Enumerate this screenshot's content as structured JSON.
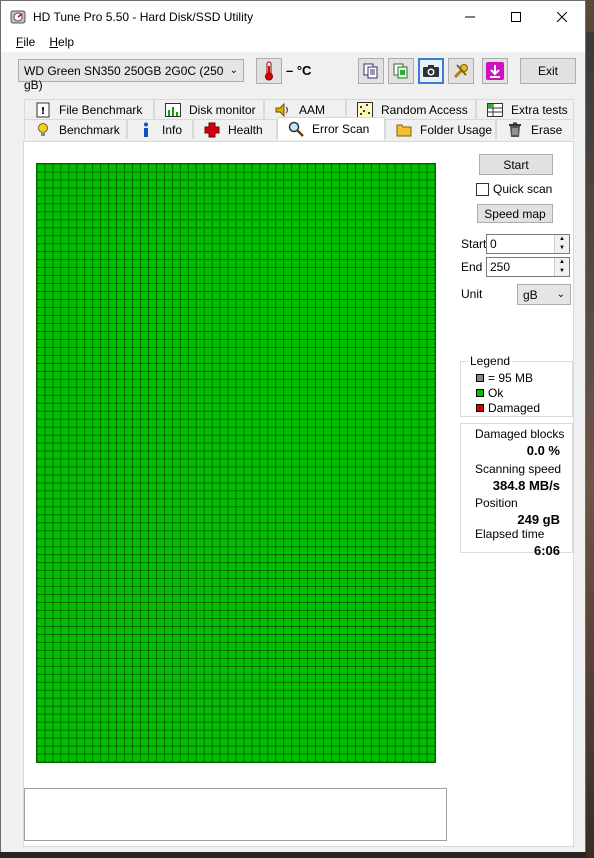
{
  "window": {
    "title": "HD Tune Pro 5.50 - Hard Disk/SSD Utility",
    "controls": {
      "minimize": "—",
      "maximize": "☐",
      "close": "✕"
    }
  },
  "menu": [
    {
      "label": "File",
      "accel": "F",
      "rest": "ile"
    },
    {
      "label": "Help",
      "accel": "H",
      "rest": "elp"
    }
  ],
  "toolbar": {
    "drive": "WD Green SN350 250GB 2G0C (250 gB)",
    "temperature": "– °C",
    "exit_label": "Exit"
  },
  "tabs": {
    "top_row": [
      "File Benchmark",
      "Disk monitor",
      "AAM",
      "Random Access",
      "Extra tests"
    ],
    "bottom_row": [
      "Benchmark",
      "Info",
      "Health",
      "Error Scan",
      "Folder Usage",
      "Erase"
    ],
    "selected": "Error Scan"
  },
  "error_scan": {
    "start_button": "Start",
    "quick_scan_label": "Quick scan",
    "quick_scan_checked": false,
    "speed_map_button": "Speed map",
    "start_label": "Start",
    "start_value": "0",
    "end_label": "End",
    "end_value": "250",
    "unit_label": "Unit",
    "unit_value": "gB",
    "legend": {
      "title": "Legend",
      "block_size": "= 95 MB",
      "ok": "Ok",
      "damaged": "Damaged",
      "colors": {
        "block": "#888888",
        "ok": "#00c000",
        "damaged": "#d00000"
      }
    },
    "stats": {
      "damaged_blocks_label": "Damaged blocks",
      "damaged_blocks_value": "0.0 %",
      "scanning_speed_label": "Scanning speed",
      "scanning_speed_value": "384.8 MB/s",
      "position_label": "Position",
      "position_value": "249 gB",
      "elapsed_label": "Elapsed time",
      "elapsed_value": "6:06"
    },
    "block_map": {
      "columns": 50,
      "rows": 75,
      "status": "ok",
      "color": "#00c000"
    }
  }
}
